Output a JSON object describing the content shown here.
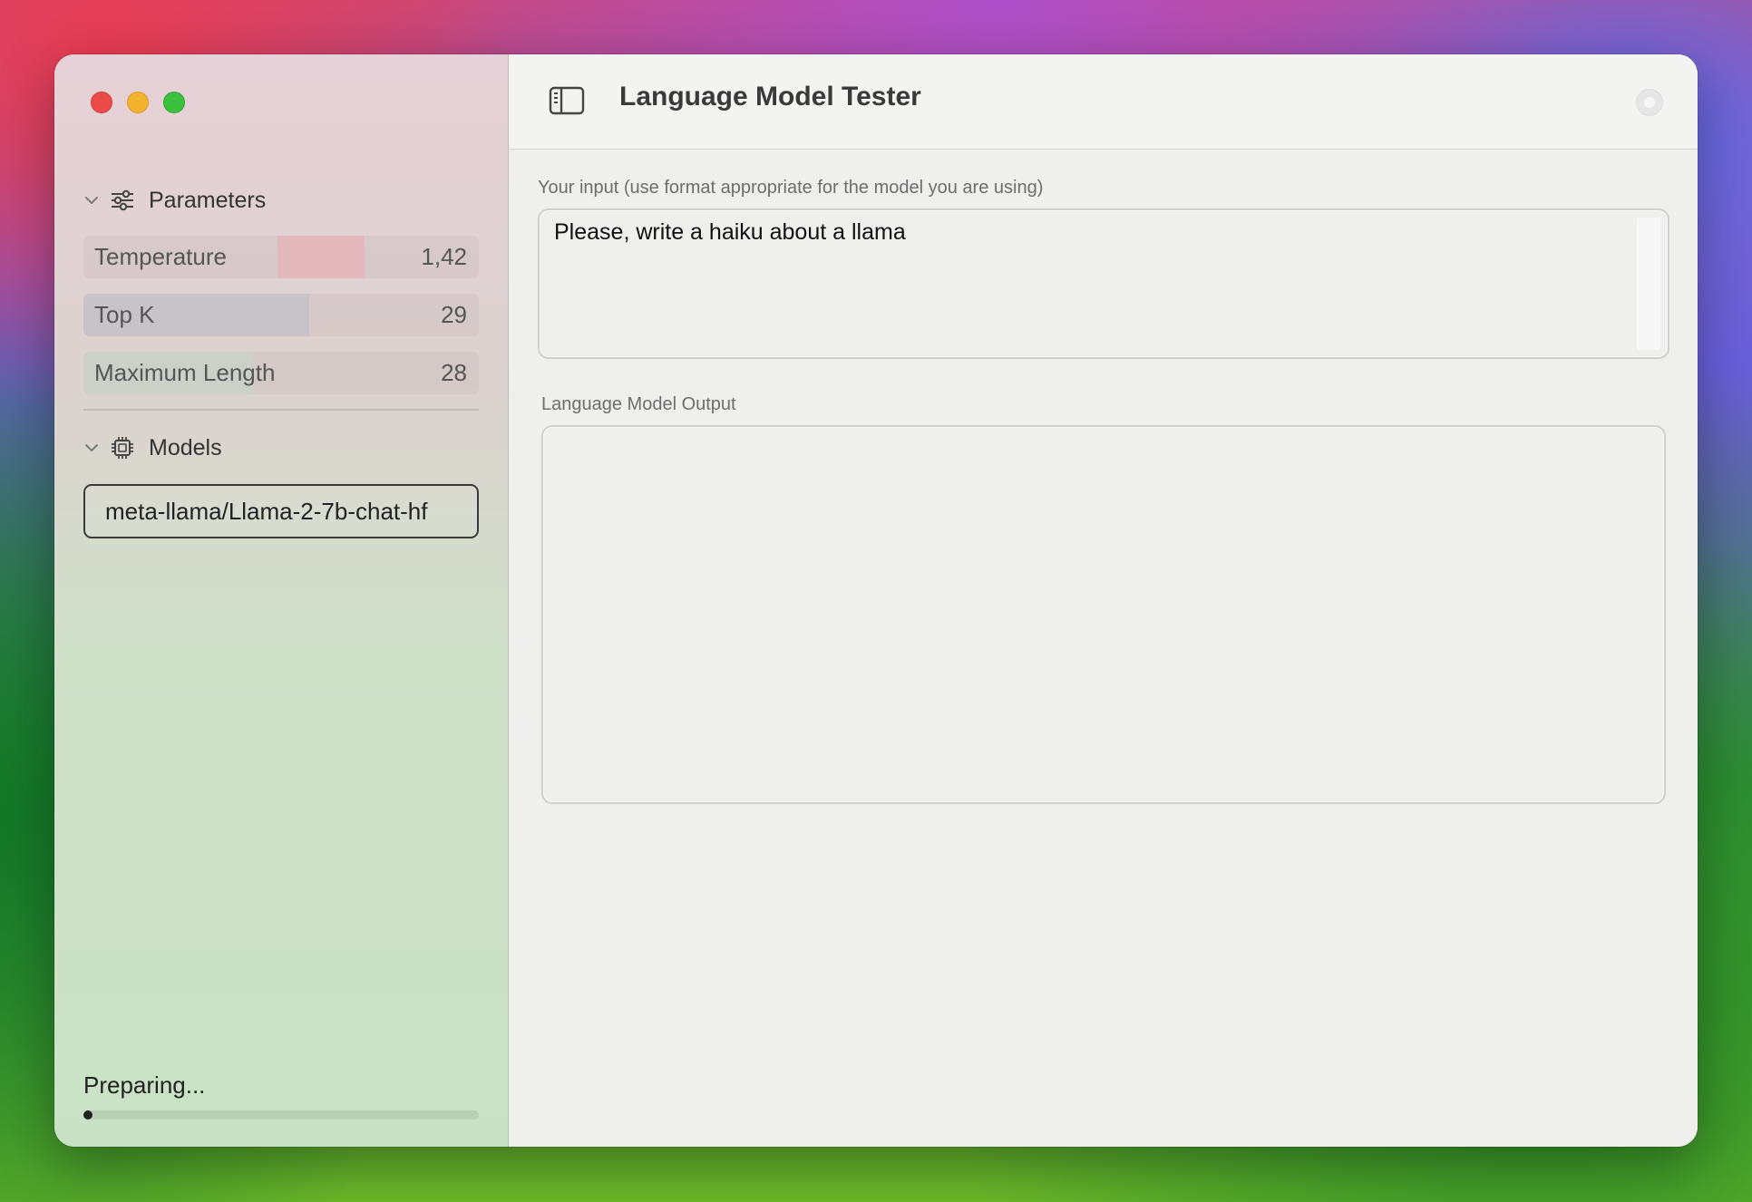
{
  "window": {
    "title": "Language Model Tester"
  },
  "sidebar": {
    "parameters_section": {
      "label": "Parameters",
      "items": [
        {
          "label": "Temperature",
          "value": "1,42",
          "fill_fraction": 0.71,
          "fill_color": "#e3b8bd"
        },
        {
          "label": "Top K",
          "value": "29",
          "fill_fraction": 0.57,
          "fill_color": "#c7c3c9"
        },
        {
          "label": "Maximum Length",
          "value": "28",
          "fill_fraction": 0.43,
          "fill_color": "#cbd1c8"
        }
      ]
    },
    "models_section": {
      "label": "Models",
      "items": [
        {
          "label": "meta-llama/Llama-2-7b-chat-hf",
          "selected": true
        }
      ]
    },
    "status": {
      "text": "Preparing...",
      "progress": 0.0
    }
  },
  "main": {
    "input": {
      "label": "Your input (use format appropriate for the model you are using)",
      "value": "Please, write a haiku about a llama"
    },
    "output": {
      "label": "Language Model Output",
      "value": ""
    }
  },
  "icons": {
    "toolbar_toggle": "sidebar-toggle-icon",
    "parameters": "sliders-icon",
    "models": "cpu-chip-icon",
    "disclosure": "chevron-down-icon",
    "status_indicator": "status-dot-icon"
  },
  "colors": {
    "close": "#ec4c47",
    "minimize": "#f3b32e",
    "maximize": "#3cc13f"
  }
}
